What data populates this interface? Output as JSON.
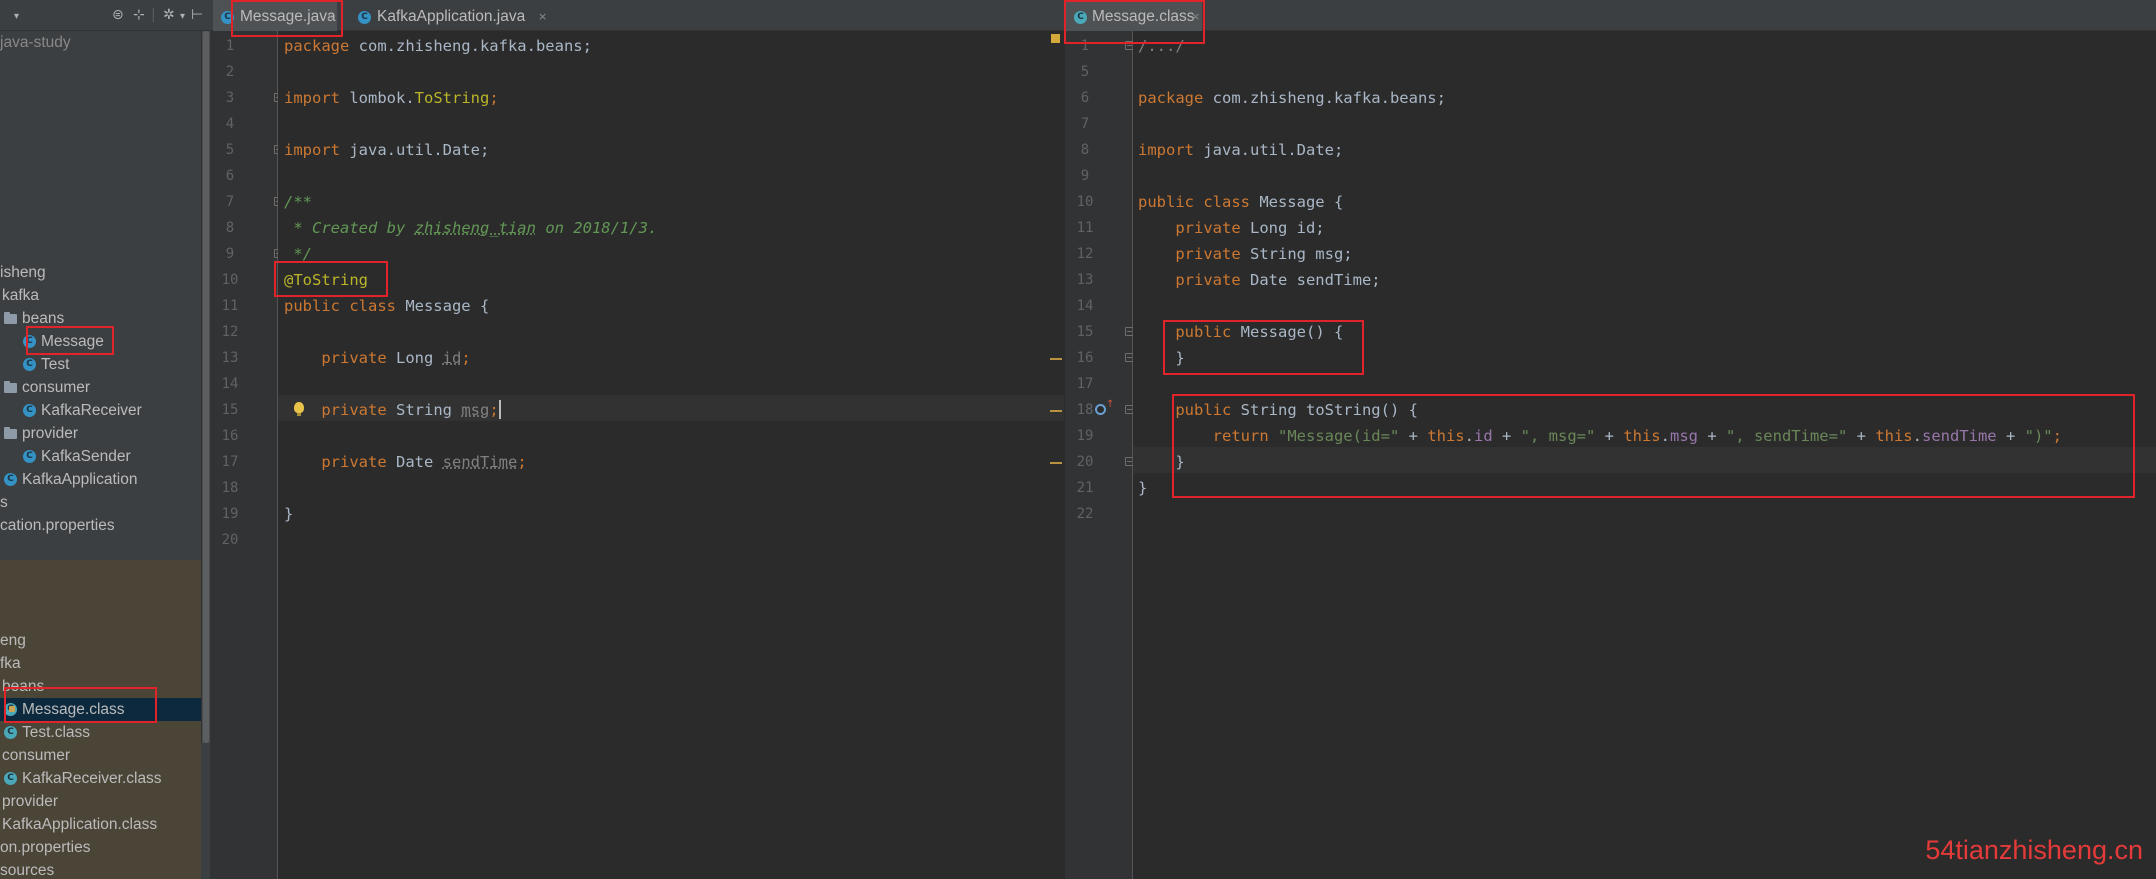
{
  "project_tree": {
    "root_label": "java-study",
    "source_items": [
      {
        "label": "isheng"
      },
      {
        "label": "kafka"
      },
      {
        "label": "beans"
      },
      {
        "label": "Message"
      },
      {
        "label": "Test"
      },
      {
        "label": "consumer"
      },
      {
        "label": "KafkaReceiver"
      },
      {
        "label": "provider"
      },
      {
        "label": "KafkaSender"
      },
      {
        "label": "KafkaApplication"
      },
      {
        "label": "s"
      },
      {
        "label": "cation.properties"
      }
    ],
    "output_items": [
      {
        "label": "eng"
      },
      {
        "label": "fka"
      },
      {
        "label": "beans"
      },
      {
        "label": "Message.class"
      },
      {
        "label": "Test.class"
      },
      {
        "label": "consumer"
      },
      {
        "label": "KafkaReceiver.class"
      },
      {
        "label": "provider"
      },
      {
        "label": "KafkaApplication.class"
      },
      {
        "label": "on.properties"
      },
      {
        "label": "sources"
      }
    ]
  },
  "left_editor": {
    "tabs": [
      {
        "label": "Message.java",
        "close": "×"
      },
      {
        "label": "KafkaApplication.java",
        "close": "×"
      }
    ],
    "line_numbers": [
      "1",
      "2",
      "3",
      "4",
      "5",
      "6",
      "7",
      "8",
      "9",
      "10",
      "11",
      "12",
      "13",
      "14",
      "15",
      "16",
      "17",
      "18",
      "19",
      "20"
    ],
    "code": {
      "l1_kw": "package",
      "l1_rest": " com.zhisheng.kafka.beans;",
      "l3_kw": "import",
      "l3_pkg": " lombok.",
      "l3_ann": "ToString",
      "l3_semi": ";",
      "l5_kw": "import",
      "l5_rest": " java.util.Date;",
      "l7": "/**",
      "l8_a": " * Created by ",
      "l8_author": "zhisheng_tian",
      "l8_b": " on 2018/1/3.",
      "l9": " */",
      "l10": "@ToString",
      "l11_kw": "public class",
      "l11_rest": " Message {",
      "l13_kw": "    private",
      "l13_type": " Long ",
      "l13_field": "id",
      "l13_semi": ";",
      "l15_kw": "    private",
      "l15_type": " String ",
      "l15_field": "msg",
      "l15_semi": ";",
      "l17_kw": "    private",
      "l17_type": " Date ",
      "l17_field": "sendTime",
      "l17_semi": ";",
      "l19": "}"
    }
  },
  "right_editor": {
    "tab": {
      "label": "Message.class",
      "close": "×"
    },
    "line_numbers": [
      "1",
      "5",
      "6",
      "7",
      "8",
      "9",
      "10",
      "11",
      "12",
      "13",
      "14",
      "15",
      "16",
      "17",
      "18",
      "19",
      "20",
      "21",
      "22"
    ],
    "code": {
      "l1": "/.../",
      "l6_kw": "package",
      "l6_rest": " com.zhisheng.kafka.beans;",
      "l8_kw": "import",
      "l8_rest": " java.util.Date;",
      "l10_kw": "public class",
      "l10_rest": " Message {",
      "l11_kw": "    private",
      "l11_rest": " Long id;",
      "l12_kw": "    private",
      "l12_rest": " String msg;",
      "l13_kw": "    private",
      "l13_rest": " Date sendTime;",
      "l15_kw": "    public",
      "l15_rest": " Message() {",
      "l16": "    }",
      "l18_kw": "    public",
      "l18_rest": " String toString() {",
      "l19_kw1": "        return",
      "l19_s1": " \"Message(id=\"",
      "l19_p1": " + ",
      "l19_this1": "this",
      "l19_f1a": ".",
      "l19_f1": "id",
      "l19_p2": " + ",
      "l19_s2": "\", msg=\"",
      "l19_p3": " + ",
      "l19_this2": "this",
      "l19_f2a": ".",
      "l19_f2": "msg",
      "l19_p4": " + ",
      "l19_s3": "\", sendTime=\"",
      "l19_p5": " + ",
      "l19_this3": "this",
      "l19_f3a": ".",
      "l19_f3": "sendTime",
      "l19_p6": " + ",
      "l19_s4": "\")\"",
      "l19_end": ";",
      "l20": "    }",
      "l21": "}"
    }
  },
  "watermark": "54tianzhisheng.cn",
  "colors": {
    "keyword": "#cc7832",
    "annotation": "#bbb529",
    "string": "#6a8759",
    "field": "#9876aa",
    "doc_comment": "#629755",
    "highlight_box": "#e0242a",
    "editor_bg": "#2b2b2b"
  },
  "icons": {
    "class_icon": "class-c-icon",
    "folder_icon": "package-folder-icon",
    "toolbar": [
      "sync-icon",
      "collapse-icon",
      "settings-icon",
      "hide-icon"
    ]
  }
}
